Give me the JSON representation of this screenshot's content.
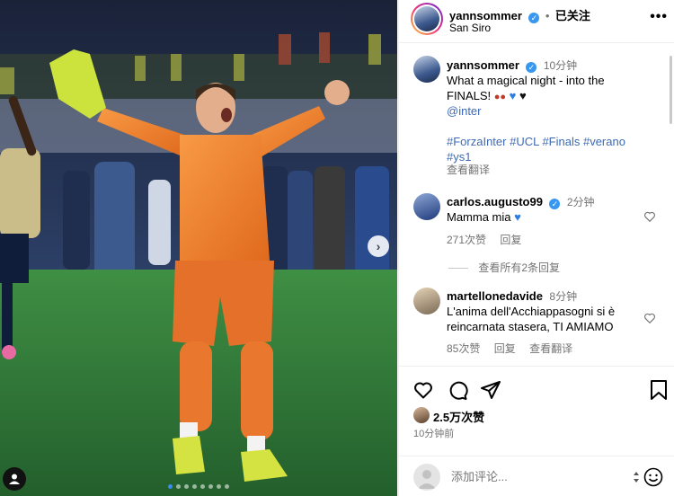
{
  "header": {
    "username": "yannsommer",
    "separator": "•",
    "follow_status": "已关注",
    "location": "San Siro",
    "more": "•••"
  },
  "caption": {
    "username": "yannsommer",
    "time": "10分钟",
    "text_line1": "What a magical night - into the",
    "text_line2": "FINALS!",
    "mention": "@inter",
    "hashtags_line1": "#ForzaInter #UCL #Finals #verano",
    "hashtags_line2": "#ys1",
    "translate": "查看翻译"
  },
  "comments": [
    {
      "username": "carlos.augusto99",
      "time": "2分钟",
      "text": "Mamma mia",
      "likes": "271次赞",
      "reply": "回复",
      "view_replies": "查看所有2条回复"
    },
    {
      "username": "martellonedavide",
      "time": "8分钟",
      "text_line1": "L'anima dell'Acchiappasogni si è",
      "text_line2": "reincarnata stasera, TI AMIAMO",
      "likes": "85次赞",
      "reply": "回复",
      "translate": "查看翻译"
    }
  ],
  "post": {
    "likes": "2.5万次赞",
    "time": "10分钟前"
  },
  "footer": {
    "comment_placeholder": "添加评论..."
  },
  "photo": {
    "carousel_count": 8,
    "carousel_active": 1,
    "next_glyph": "›"
  },
  "colors": {
    "kit_orange": "#f07d2e",
    "verified_blue": "#3897f0",
    "link_blue": "#00376b",
    "pitch_green": "#2f7a3a"
  }
}
